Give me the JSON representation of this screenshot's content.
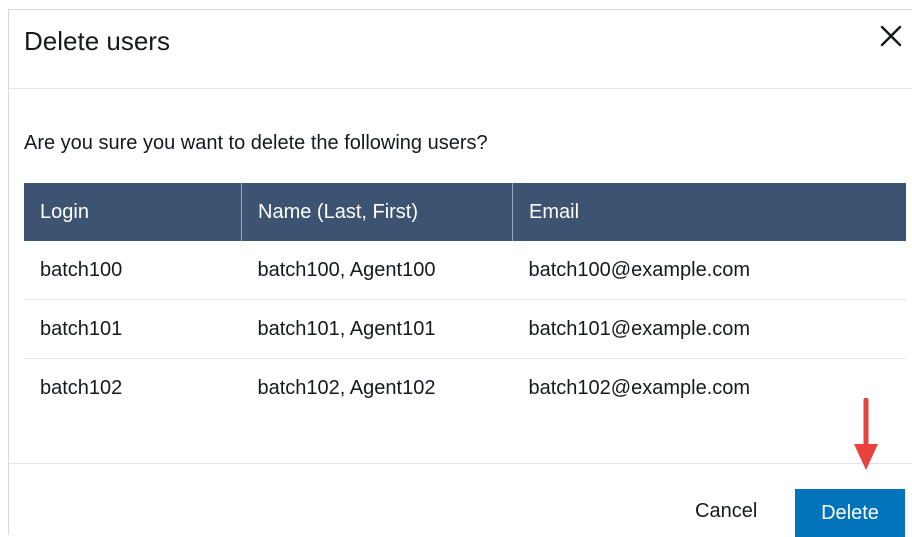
{
  "dialog": {
    "title": "Delete users",
    "prompt": "Are you sure you want to delete the following users?",
    "close_icon": "close-icon"
  },
  "table": {
    "headers": [
      "Login",
      "Name (Last, First)",
      "Email"
    ],
    "rows": [
      [
        "batch100",
        "batch100, Agent100",
        "batch100@example.com"
      ],
      [
        "batch101",
        "batch101, Agent101",
        "batch101@example.com"
      ],
      [
        "batch102",
        "batch102, Agent102",
        "batch102@example.com"
      ]
    ]
  },
  "footer": {
    "cancel_label": "Cancel",
    "delete_label": "Delete"
  },
  "colors": {
    "header_bg": "#3d5372",
    "primary_button": "#0073bb",
    "annotation_arrow": "#e8423f"
  }
}
